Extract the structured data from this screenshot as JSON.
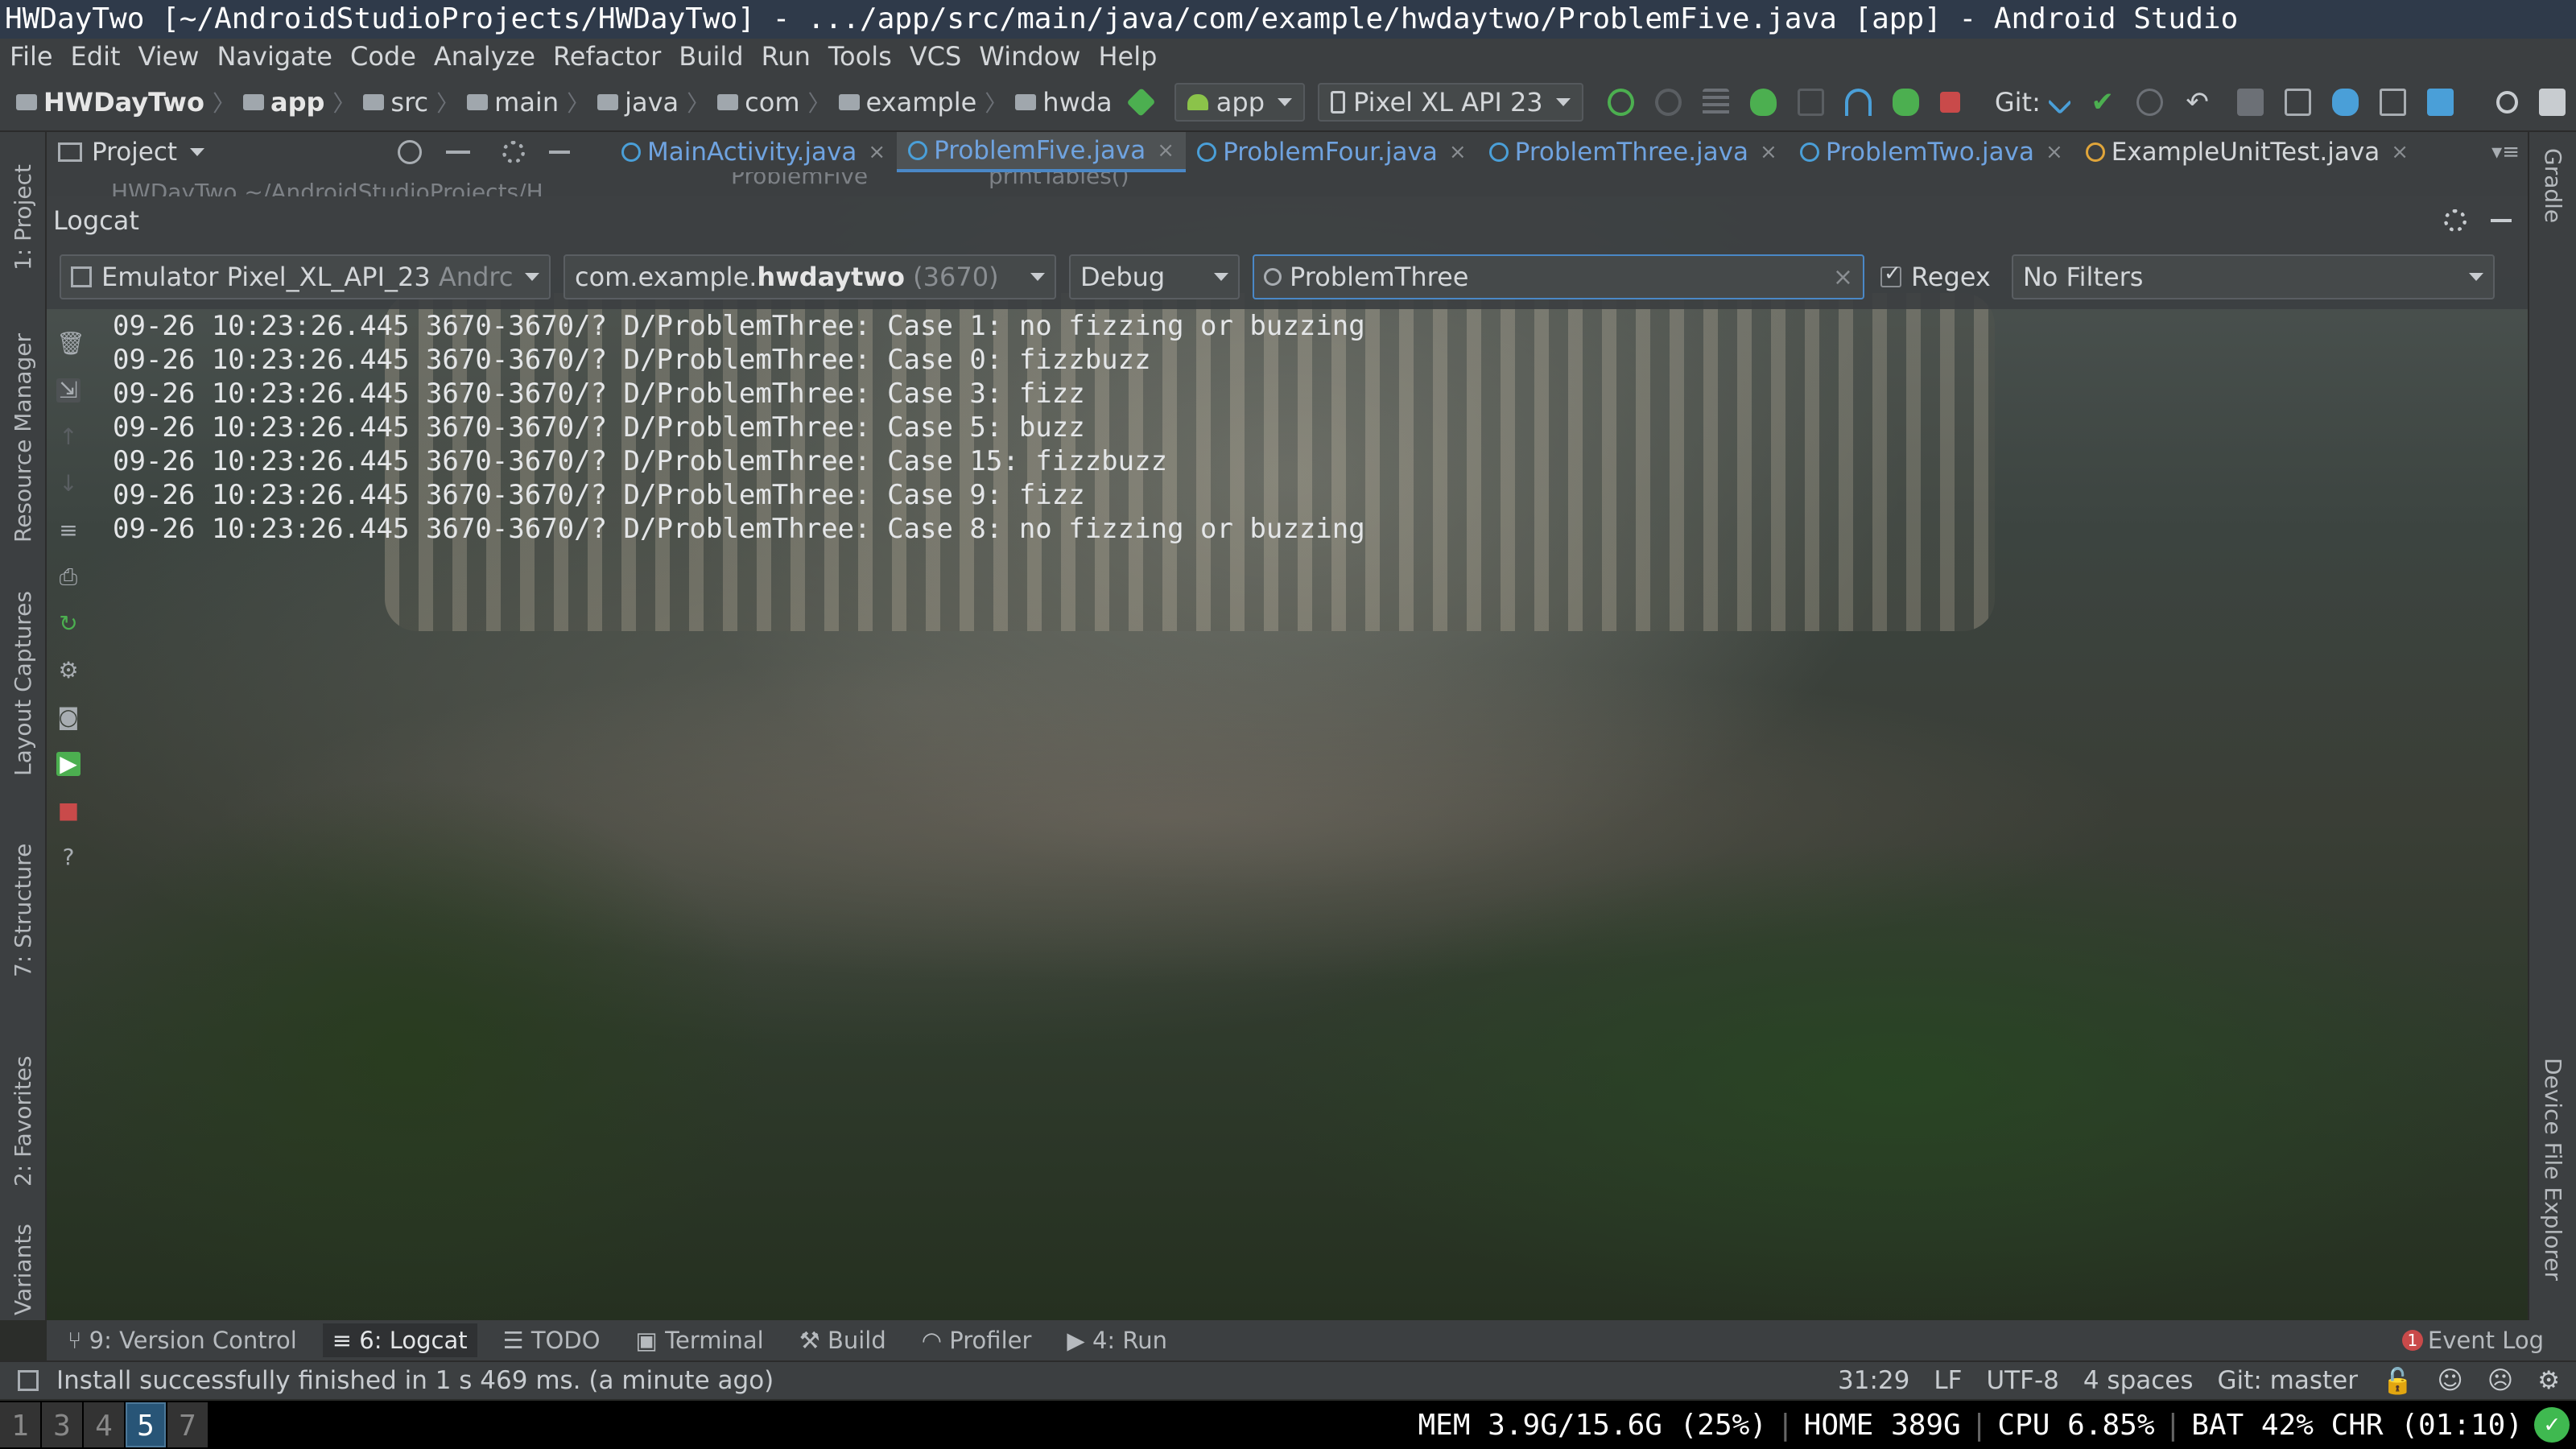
{
  "window": {
    "title": "HWDayTwo [~/AndroidStudioProjects/HWDayTwo] - .../app/src/main/java/com/example/hwdaytwo/ProblemFive.java [app] - Android Studio"
  },
  "menu": [
    "File",
    "Edit",
    "View",
    "Navigate",
    "Code",
    "Analyze",
    "Refactor",
    "Build",
    "Run",
    "Tools",
    "VCS",
    "Window",
    "Help"
  ],
  "breadcrumbs": [
    "HWDayTwo",
    "app",
    "src",
    "main",
    "java",
    "com",
    "example",
    "hwda"
  ],
  "run_config": "app",
  "device": "Pixel XL API 23",
  "git_label": "Git:",
  "project_panel": {
    "label": "Project",
    "tree_item": "HWDayTwo ~/AndroidStudioProjects/H"
  },
  "editor_tabs": [
    {
      "label": "MainActivity.java",
      "active": false
    },
    {
      "label": "ProblemFive.java",
      "active": true
    },
    {
      "label": "ProblemFour.java",
      "active": false
    },
    {
      "label": "ProblemThree.java",
      "active": false
    },
    {
      "label": "ProblemTwo.java",
      "active": false
    },
    {
      "label": "ExampleUnitTest.java",
      "active": false
    }
  ],
  "editor_breadcrumb": [
    "ProblemFive",
    "printTables()"
  ],
  "logcat": {
    "title": "Logcat",
    "device_select": "Emulator Pixel_XL_API_23",
    "device_suffix": "Andrc",
    "process_prefix": "com.example.",
    "process_bold": "hwdaytwo",
    "process_pid": "(3670)",
    "level": "Debug",
    "search": "ProblemThree",
    "regex_label": "Regex",
    "regex_checked": true,
    "filter": "No Filters",
    "lines": [
      "09-26 10:23:26.445 3670-3670/? D/ProblemThree: Case 1: no fizzing or buzzing",
      "09-26 10:23:26.445 3670-3670/? D/ProblemThree: Case 0: fizzbuzz",
      "09-26 10:23:26.445 3670-3670/? D/ProblemThree: Case 3: fizz",
      "09-26 10:23:26.445 3670-3670/? D/ProblemThree: Case 5: buzz",
      "09-26 10:23:26.445 3670-3670/? D/ProblemThree: Case 15: fizzbuzz",
      "09-26 10:23:26.445 3670-3670/? D/ProblemThree: Case 9: fizz",
      "09-26 10:23:26.445 3670-3670/? D/ProblemThree: Case 8: no fizzing or buzzing"
    ]
  },
  "left_stripe": [
    "1: Project",
    "Resource Manager",
    "Layout Captures",
    "7: Structure",
    "2: Favorites",
    "Variants"
  ],
  "right_stripe": [
    "Gradle",
    "Device File Explorer"
  ],
  "tool_windows": [
    {
      "label": "9: Version Control",
      "active": false
    },
    {
      "label": "6: Logcat",
      "active": true
    },
    {
      "label": "TODO",
      "active": false
    },
    {
      "label": "Terminal",
      "active": false
    },
    {
      "label": "Build",
      "active": false
    },
    {
      "label": "Profiler",
      "active": false
    },
    {
      "label": "4: Run",
      "active": false
    }
  ],
  "event_log": {
    "label": "Event Log",
    "count": "1"
  },
  "status": {
    "message": "Install successfully finished in 1 s 469 ms. (a minute ago)",
    "position": "31:29",
    "line_sep": "LF",
    "encoding": "UTF-8",
    "indent": "4 spaces",
    "vcs": "Git: master"
  },
  "i3bar": {
    "workspaces": [
      "1",
      "3",
      "4",
      "5",
      "7"
    ],
    "active_workspace": "5",
    "mem": "MEM 3.9G/15.6G (25%)",
    "home": "HOME 389G",
    "cpu": "CPU 6.85%",
    "bat": "BAT 42% CHR (01:10)"
  },
  "colors": {
    "accent": "#4a88c7",
    "tab_text": "#6fa3e0",
    "active_workspace": "#285577",
    "ok": "#3fb950",
    "stop": "#c94a4a"
  }
}
